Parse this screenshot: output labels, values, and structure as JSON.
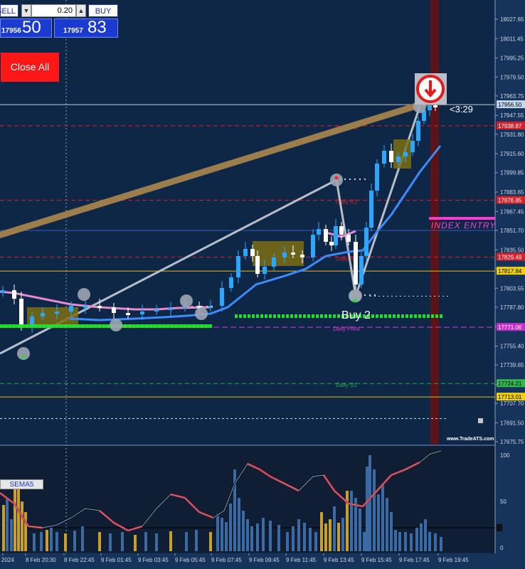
{
  "trade_panel": {
    "sell_label": "SELL",
    "buy_label": "BUY",
    "lot_value": "0.20",
    "bid_small": "17956",
    "bid_big": "50",
    "ask_small": "17957",
    "ask_big": "83",
    "stepper_down": "▼",
    "stepper_up": "▲"
  },
  "close_all_label": "Close All",
  "watermark": "www.TradeATS.com",
  "timer": "<3:29",
  "buy_signal": "Buy 2",
  "index_entry": "INDEX ENTRY",
  "indicator_label": "SEMA5",
  "price_axis": [
    "18027.65",
    "18011.45",
    "17995.25",
    "17979.50",
    "17963.75",
    "17947.55",
    "17931.80",
    "17915.60",
    "17899.85",
    "17883.65",
    "17867.45",
    "17851.70",
    "17835.50",
    "17819.75",
    "17803.55",
    "17787.80",
    "17771.60",
    "17755.40",
    "17739.65",
    "17723.45",
    "17707.70",
    "17691.50",
    "17675.75"
  ],
  "price_tags": [
    {
      "label": "17956.50",
      "kind": "current"
    },
    {
      "label": "17938.87",
      "kind": "r3"
    },
    {
      "label": "17876.85",
      "kind": "r2"
    },
    {
      "label": "17829.49",
      "kind": "r1"
    },
    {
      "label": "17817.84",
      "kind": "yellow"
    },
    {
      "label": "17771.06",
      "kind": "pivot"
    },
    {
      "label": "17724.21",
      "kind": "s1"
    },
    {
      "label": "17713.01",
      "kind": "yellow2"
    }
  ],
  "level_labels": {
    "r3": "Daily R3",
    "r2": "Daily R2",
    "r1": "Daily R1",
    "pivot": "Daily Pivot",
    "s1": "Daily S1"
  },
  "indicator_axis": [
    "100",
    "50",
    "0"
  ],
  "time_axis": [
    "2024",
    "8 Feb 20:30",
    "8 Feb 22:45",
    "9 Feb 01:45",
    "9 Feb 03:45",
    "9 Feb 05:45",
    "9 Feb 07:45",
    "9 Feb 09:45",
    "9 Feb 11:45",
    "9 Feb 13:45",
    "9 Feb 15:45",
    "9 Feb 17:45",
    "9 Feb 19:45"
  ],
  "colors": {
    "bg": "#0f2747",
    "bull": "#2aa8ff",
    "bear": "#ffffff",
    "trend": "#9c7d4c",
    "ma": "#3d8cff",
    "signal": "#23e02a",
    "pivot": "#d53ad5",
    "r": "#d8202a",
    "s1": "#23a84a",
    "yellow": "#e0c21a"
  }
}
